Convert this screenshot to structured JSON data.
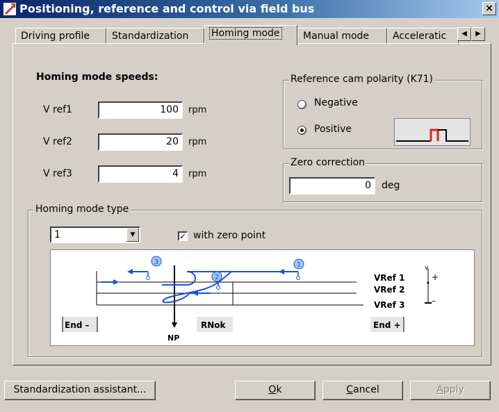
{
  "window": {
    "title": "Positioning, reference and control via field bus",
    "close_label": "×"
  },
  "tabs": [
    {
      "label": "Driving profile"
    },
    {
      "label": "Standardization"
    },
    {
      "label": "Homing mode",
      "active": true
    },
    {
      "label": "Manual mode"
    },
    {
      "label": "Acceleratic"
    }
  ],
  "tab_scroll": {
    "left": "◀",
    "right": "▶"
  },
  "speeds": {
    "heading": "Homing mode speeds:",
    "rows": [
      {
        "label": "V ref1",
        "value": "100",
        "unit": "rpm"
      },
      {
        "label": "V ref2",
        "value": "20",
        "unit": "rpm"
      },
      {
        "label": "V ref3",
        "value": "4",
        "unit": "rpm"
      }
    ]
  },
  "polarity": {
    "title": "Reference cam polarity (K71)",
    "options": [
      {
        "label": "Negative",
        "selected": false
      },
      {
        "label": "Positive",
        "selected": true
      }
    ]
  },
  "zero_correction": {
    "title": "Zero correction",
    "value": "0",
    "unit": "deg"
  },
  "homing_type": {
    "title": "Homing mode type",
    "selected": "1",
    "checkbox_label": "with zero point",
    "checkbox_checked": true
  },
  "diagram": {
    "markers": [
      "3",
      "2",
      "1"
    ],
    "labels": {
      "vref1": "VRef 1",
      "vref2": "VRef 2",
      "vref3": "VRef 3",
      "v_axis": "v",
      "plus": "+",
      "minus": "–",
      "end_minus": "End –",
      "np": "NP",
      "rnok": "RNok",
      "end_plus": "End +"
    },
    "colors": {
      "path": "#1a4fd6",
      "marker_fill": "#9fc6ff"
    }
  },
  "buttons": {
    "assistant": "Standardization assistant...",
    "ok_prefix": "O",
    "ok_rest": "k",
    "cancel_prefix": "C",
    "cancel_rest": "ancel",
    "apply_prefix": "A",
    "apply_rest": "pply"
  }
}
